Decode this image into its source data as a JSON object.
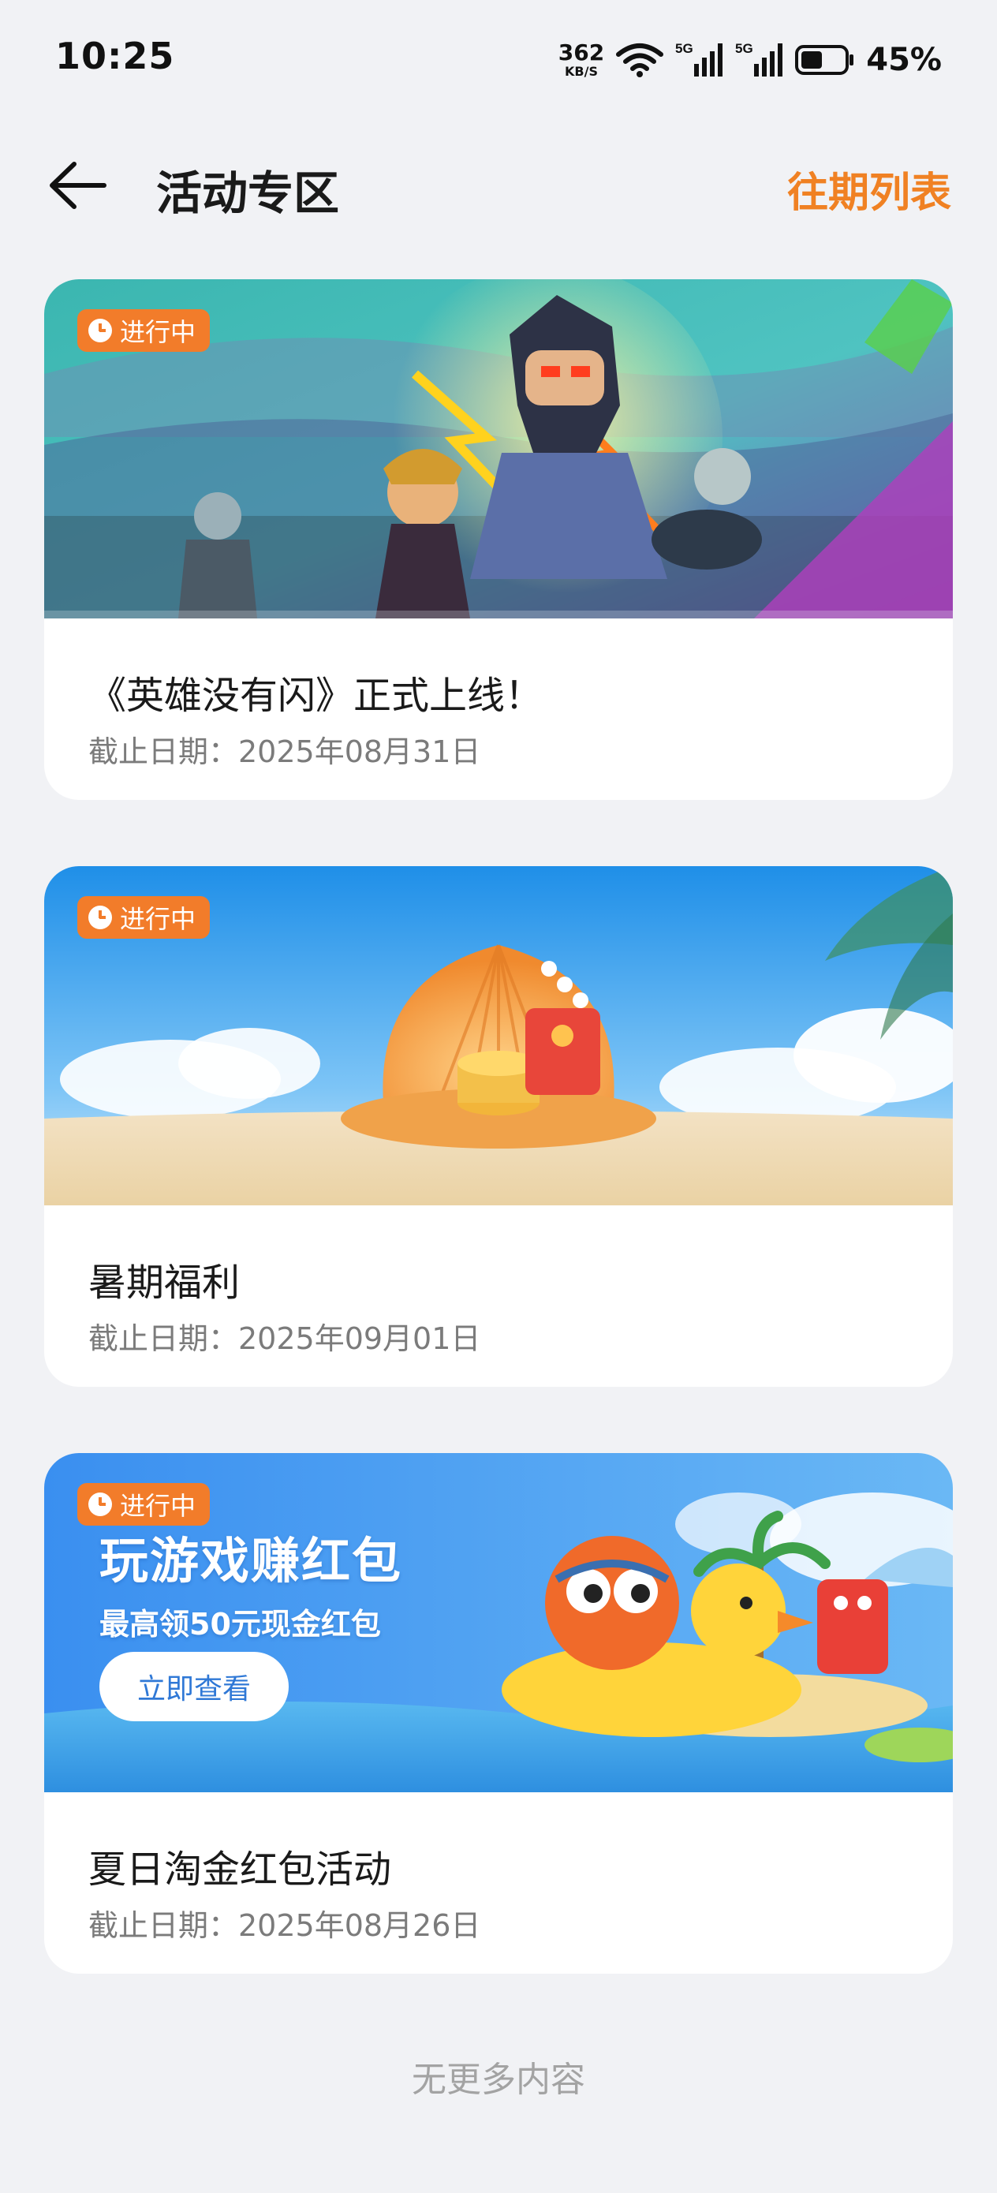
{
  "status_bar": {
    "time": "10:25",
    "net_speed": "362",
    "net_unit": "KB/S",
    "network_1": "5G",
    "network_2": "5G",
    "battery": "45%",
    "icons": [
      "wifi-icon",
      "signal-icon",
      "battery-icon"
    ]
  },
  "header": {
    "title": "活动专区",
    "history_link": "往期列表",
    "back_icon": "back-arrow-icon"
  },
  "cards": [
    {
      "status": "进行中",
      "title": "《英雄没有闪》正式上线！",
      "deadline": "截止日期：2025年08月31日"
    },
    {
      "status": "进行中",
      "title": "暑期福利",
      "deadline": "截止日期：2025年09月01日"
    },
    {
      "status": "进行中",
      "banner_title": "玩游戏赚红包",
      "banner_subtitle": "最高领50元现金红包",
      "banner_button": "立即查看",
      "title": "夏日淘金红包活动",
      "deadline": "截止日期：2025年08月26日"
    }
  ],
  "footer": {
    "no_more": "无更多内容"
  },
  "colors": {
    "accent": "#f08123",
    "tag_bg": "#f27c2a",
    "page_bg": "#f1f2f5"
  }
}
